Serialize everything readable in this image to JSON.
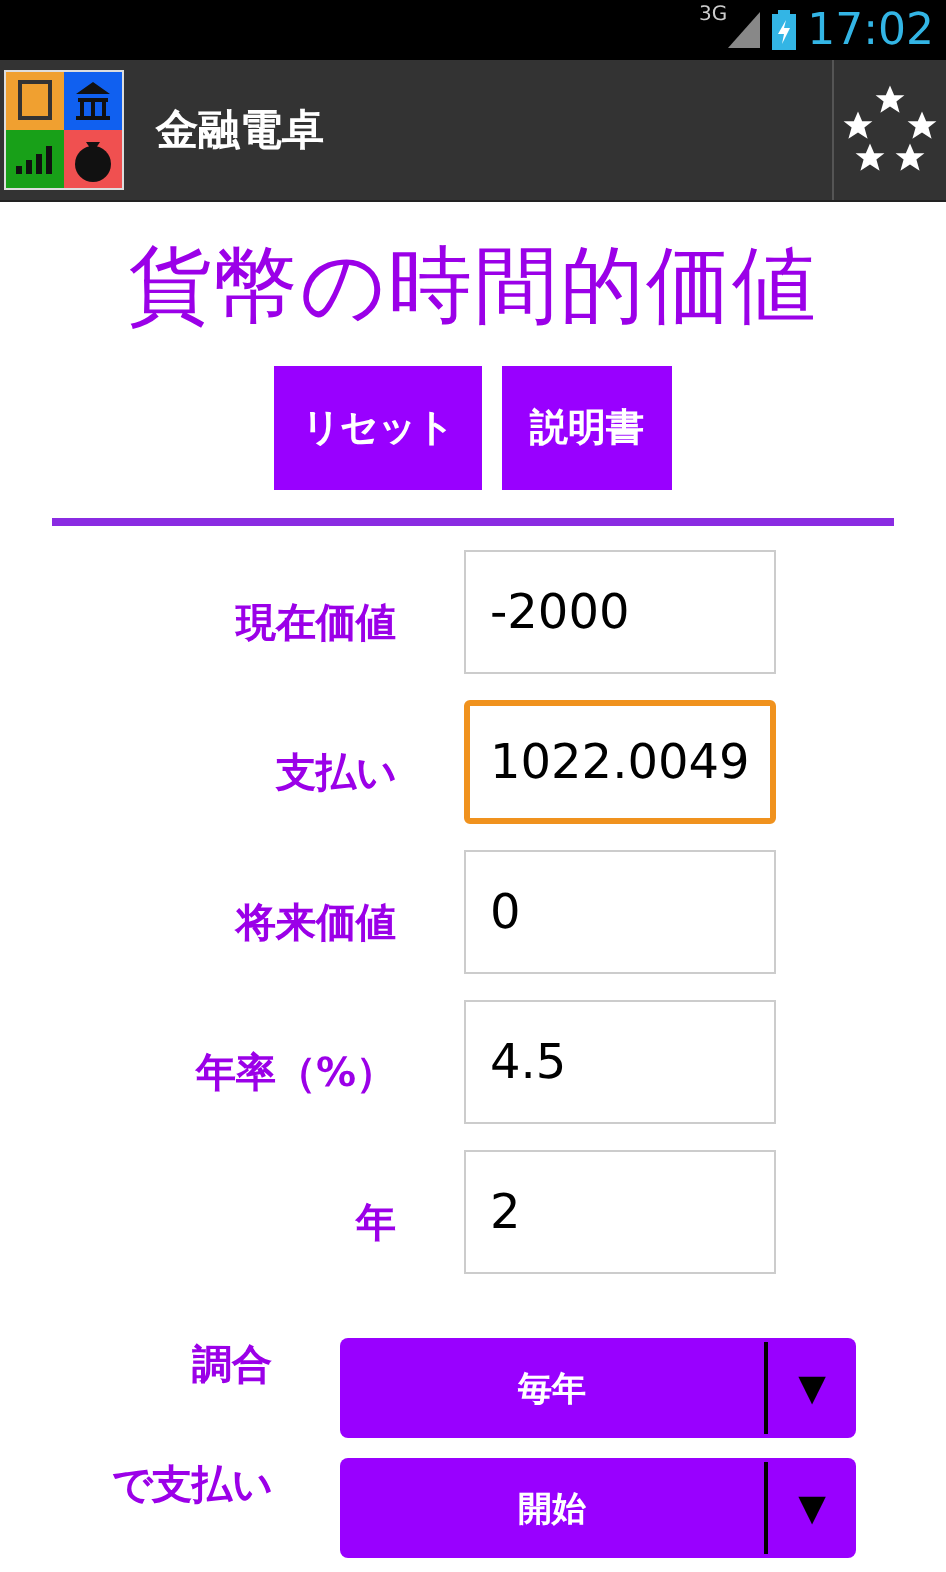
{
  "status_bar": {
    "network": "3G",
    "time": "17:02"
  },
  "action_bar": {
    "title": "金融電卓"
  },
  "heading": "貨幣の時間的価値",
  "buttons": [
    "リセット",
    "説明書"
  ],
  "fields": [
    {
      "label": "現在価値",
      "value": "-2000",
      "focused": false
    },
    {
      "label": "支払い",
      "value": "1022.0049",
      "focused": true
    },
    {
      "label": "将来価値",
      "value": "0",
      "focused": false
    },
    {
      "label": "年率（%）",
      "value": "4.5",
      "focused": false
    },
    {
      "label": "年",
      "value": "2",
      "focused": false
    }
  ],
  "dropdowns": [
    {
      "label": "調合",
      "value": "毎年",
      "arrow": "▼"
    },
    {
      "label": "で支払い",
      "value": "開始",
      "arrow": "▼"
    }
  ]
}
